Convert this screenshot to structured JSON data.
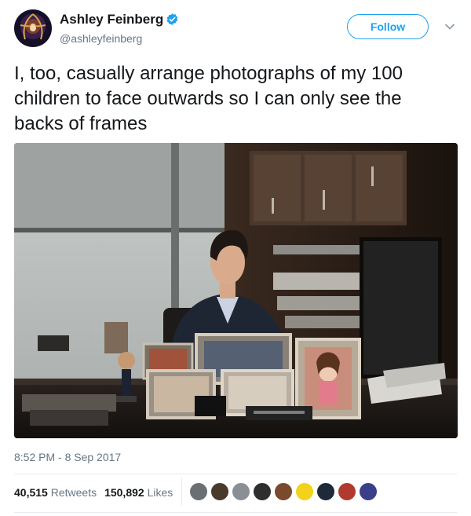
{
  "user": {
    "display_name": "Ashley Feinberg",
    "handle": "@ashleyfeinberg",
    "verified": true
  },
  "actions": {
    "follow_label": "Follow"
  },
  "tweet": {
    "text": "I, too, casually arrange photographs of my 100 children to face outwards so I can only see the backs of frames",
    "timestamp": "8:52 PM - 8 Sep 2017"
  },
  "stats": {
    "retweets_count": "40,515",
    "retweets_label": "Retweets",
    "likes_count": "150,892",
    "likes_label": "Likes"
  },
  "likers": [
    {
      "icon": "liker-avatar",
      "color": "#6b6f73"
    },
    {
      "icon": "liker-avatar",
      "color": "#4a3a2c"
    },
    {
      "icon": "liker-avatar",
      "color": "#8a8f96"
    },
    {
      "icon": "liker-avatar",
      "color": "#2e2e2e"
    },
    {
      "icon": "liker-avatar",
      "color": "#7a4a2e"
    },
    {
      "icon": "liker-avatar",
      "color": "#f3d21b"
    },
    {
      "icon": "liker-avatar",
      "color": "#1e2a3a"
    },
    {
      "icon": "liker-avatar",
      "color": "#b03a2e"
    },
    {
      "icon": "liker-avatar",
      "color": "#3b3f8a"
    }
  ],
  "colors": {
    "accent": "#1da1f2",
    "secondary_text": "#657786",
    "primary_text": "#14171a"
  }
}
